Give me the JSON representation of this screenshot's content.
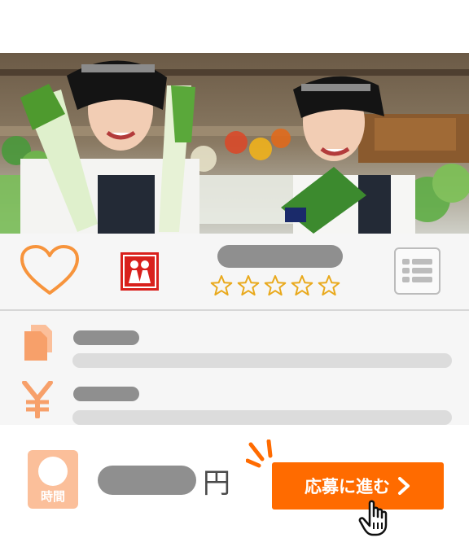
{
  "hero": {
    "alt_icon": "supermarket-staff-photo"
  },
  "rating": {
    "favorite_icon": "heart-icon",
    "logo_icon": "store-logo-icon",
    "stars": 5,
    "list_icon": "list-icon"
  },
  "info": {
    "copy_icon": "documents-icon",
    "yen_icon": "yen-icon"
  },
  "bottom": {
    "time_label": "時間",
    "price_unit": "円",
    "apply_label": "応募に進む"
  },
  "colors": {
    "accent": "#ff6b00",
    "icon_orange": "#fbbf9a",
    "star": "#e9a91c",
    "placeholder": "#8f8f8f"
  }
}
